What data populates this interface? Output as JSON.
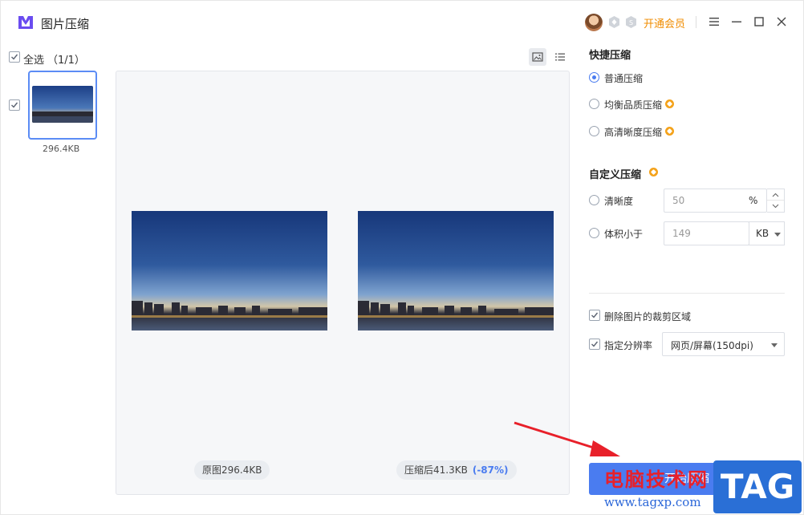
{
  "app": {
    "title": "图片压缩",
    "open_vip": "开通会员"
  },
  "file_list": {
    "select_all_label": "全选",
    "select_all_count": "（1/1）",
    "items": [
      {
        "size": "296.4KB",
        "checked": true
      }
    ]
  },
  "preview": {
    "original_label": "原图296.4KB",
    "compressed_label": "压缩后41.3KB",
    "reduction": "(-87%)"
  },
  "quick": {
    "title": "快捷压缩",
    "options": [
      {
        "label": "普通压缩",
        "selected": true,
        "vip": false
      },
      {
        "label": "均衡品质压缩",
        "selected": false,
        "vip": true
      },
      {
        "label": "高清晰度压缩",
        "selected": false,
        "vip": true
      }
    ]
  },
  "custom": {
    "title": "自定义压缩",
    "clarity_label": "清晰度",
    "clarity_value": "50",
    "clarity_unit": "%",
    "size_label": "体积小于",
    "size_value": "149",
    "size_unit": "KB"
  },
  "extras": {
    "remove_crop_label": "删除图片的裁剪区域",
    "remove_crop_checked": true,
    "resolution_label": "指定分辨率",
    "resolution_checked": true,
    "resolution_value": "网页/屏幕(150dpi)"
  },
  "action": {
    "start_label": "开始压缩"
  },
  "watermark": {
    "text": "电脑技术网",
    "url": "www.tagxp.com",
    "tag": "TAG"
  },
  "colors": {
    "accent": "#4a7cf0",
    "vip": "#f08c00",
    "annotation": "#e8202a"
  }
}
